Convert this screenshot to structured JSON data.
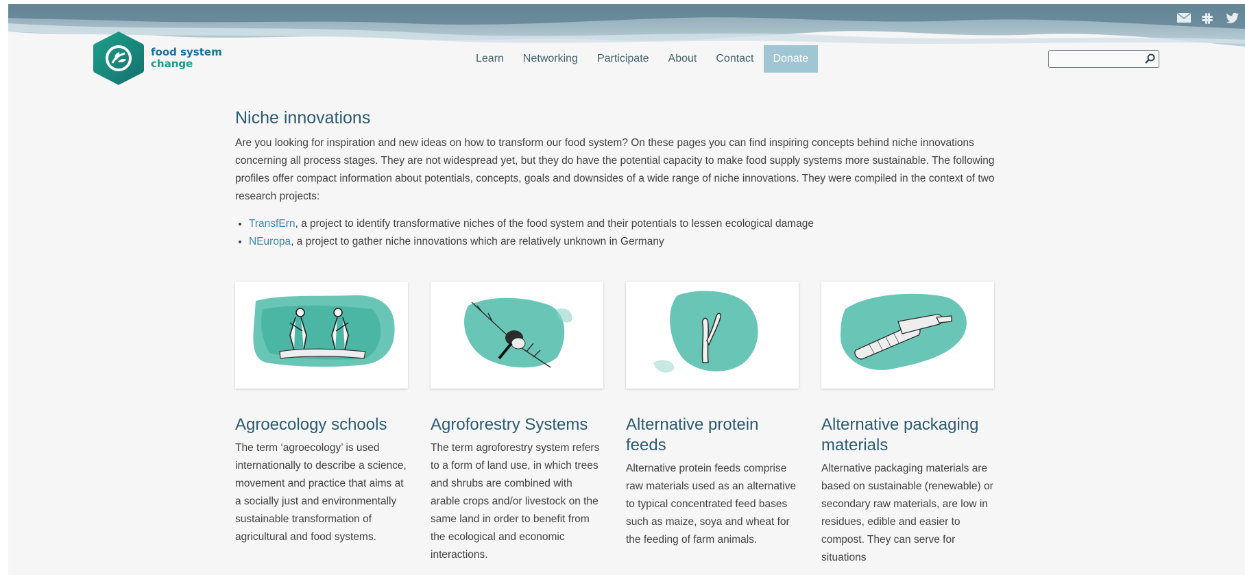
{
  "brand": {
    "line1": "food system",
    "line2": "change",
    "colors": {
      "teal": "#1c9a85",
      "blue": "#1f6e9a"
    }
  },
  "social": [
    {
      "icon": "mail-icon"
    },
    {
      "icon": "slack-icon"
    },
    {
      "icon": "twitter-icon"
    }
  ],
  "nav": {
    "items": [
      "Learn",
      "Networking",
      "Participate",
      "About",
      "Contact"
    ],
    "donate": "Donate"
  },
  "search": {
    "placeholder": "",
    "value": "",
    "icon": "search-icon"
  },
  "page": {
    "title": "Niche innovations",
    "intro": "Are you looking for inspiration and new ideas on how to transform our food system? On these pages you can find inspiring concepts behind niche innovations concerning all process stages. They are not widespread yet, but they do have the potential capacity to make food supply systems more sustainable. The following profiles offer compact information about potentials, concepts, goals and downsides of a wide range of niche innovations. They were compiled in the context of two research projects:",
    "projects": [
      {
        "link": "TransfErn",
        "text": ", a project to identify transformative niches of the food system and their potentials to lessen ecological damage"
      },
      {
        "link": "NEuropa",
        "text": ", a project to gather niche innovations which are relatively unknown in Germany"
      }
    ]
  },
  "cards": [
    {
      "title": "Agroecology schools",
      "text": "The term ‘agroecology’ is used internationally to describe a science, movement and practice that aims at a socially just and environmentally sustainable transformation of agricultural and food systems."
    },
    {
      "title": "Agroforestry Systems",
      "text": "The term agroforestry system refers to a form of land use, in which trees and shrubs are combined with arable crops and/or livestock on the same land in order to benefit from the ecological and economic interactions."
    },
    {
      "title": "Alternative protein feeds",
      "text": "Alternative protein feeds comprise raw materials used as an alternative to typical concentrated feed bases such as maize, soya and wheat for the feeding of farm animals."
    },
    {
      "title": "Alternative packaging materials",
      "text": "Alternative packaging materials are based on sustainable (renewable) or secondary raw materials, are low in residues, edible and easier to compost. They can serve for situations"
    }
  ]
}
